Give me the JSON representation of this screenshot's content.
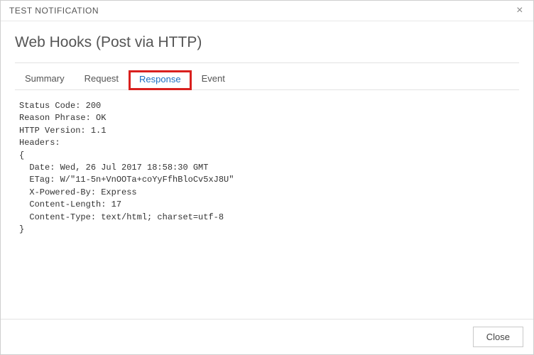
{
  "window": {
    "title": "TEST NOTIFICATION"
  },
  "heading": "Web Hooks (Post via HTTP)",
  "tabs": {
    "summary": "Summary",
    "request": "Request",
    "response": "Response",
    "event": "Event"
  },
  "response": {
    "status_code_label": "Status Code:",
    "status_code": "200",
    "reason_label": "Reason Phrase:",
    "reason": "OK",
    "http_version_label": "HTTP Version:",
    "http_version": "1.1",
    "headers_label": "Headers:",
    "headers": {
      "Date": "Wed, 26 Jul 2017 18:58:30 GMT",
      "ETag": "W/\"11-5n+VnOOTa+coYyFfhBloCv5xJ8U\"",
      "X-Powered-By": "Express",
      "Content-Length": "17",
      "Content-Type": "text/html; charset=utf-8"
    }
  },
  "footer": {
    "close": "Close"
  }
}
